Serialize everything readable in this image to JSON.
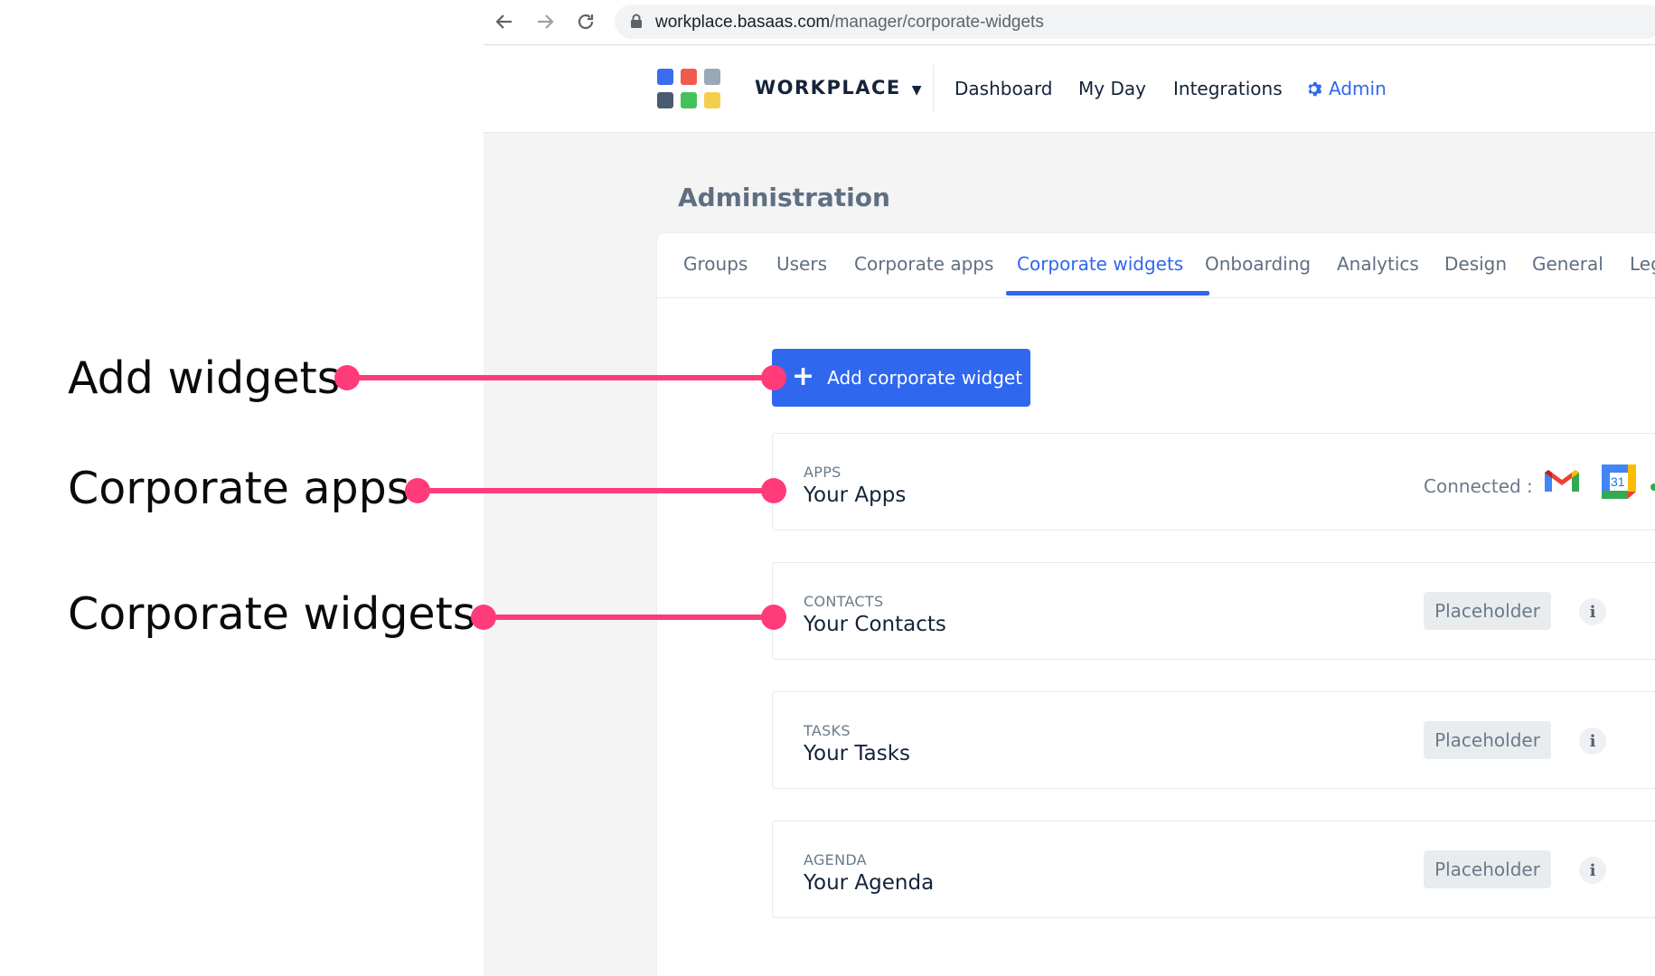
{
  "annotations": [
    {
      "label": "Add widgets"
    },
    {
      "label": "Corporate apps"
    },
    {
      "label": "Corporate widgets"
    }
  ],
  "browser": {
    "url_host": "workplace.basaas.com",
    "url_path": "/manager/corporate-widgets",
    "icons": [
      "back-arrow-icon",
      "forward-arrow-icon",
      "reload-icon",
      "lock-icon"
    ]
  },
  "header": {
    "brand": "WORKPLACE",
    "brand_caret": "▼",
    "nav": [
      "Dashboard",
      "My Day",
      "Integrations",
      "Admin"
    ],
    "logo_colors": [
      "#3b6cf0",
      "#ef5b4e",
      "#9aa7b6",
      "#4a5a70",
      "#45c15c",
      "#f3cf4d"
    ]
  },
  "page": {
    "title": "Administration",
    "tabs": [
      "Groups",
      "Users",
      "Corporate apps",
      "Corporate widgets",
      "Onboarding",
      "Analytics",
      "Design",
      "General",
      "Leg"
    ],
    "active_tab": "Corporate widgets"
  },
  "content": {
    "add_button": "Add corporate widget",
    "cards": [
      {
        "category": "APPS",
        "title": "Your Apps",
        "connected_label": "Connected :",
        "connected_apps": [
          "gmail-icon",
          "google-calendar-icon"
        ],
        "calendar_day": "31"
      },
      {
        "category": "CONTACTS",
        "title": "Your Contacts",
        "badge": "Placeholder",
        "info": "i"
      },
      {
        "category": "TASKS",
        "title": "Your Tasks",
        "badge": "Placeholder",
        "info": "i"
      },
      {
        "category": "AGENDA",
        "title": "Your Agenda",
        "badge": "Placeholder",
        "info": "i"
      }
    ]
  },
  "colors": {
    "accent": "#2f67ef",
    "annotation": "#ff3b7a"
  }
}
